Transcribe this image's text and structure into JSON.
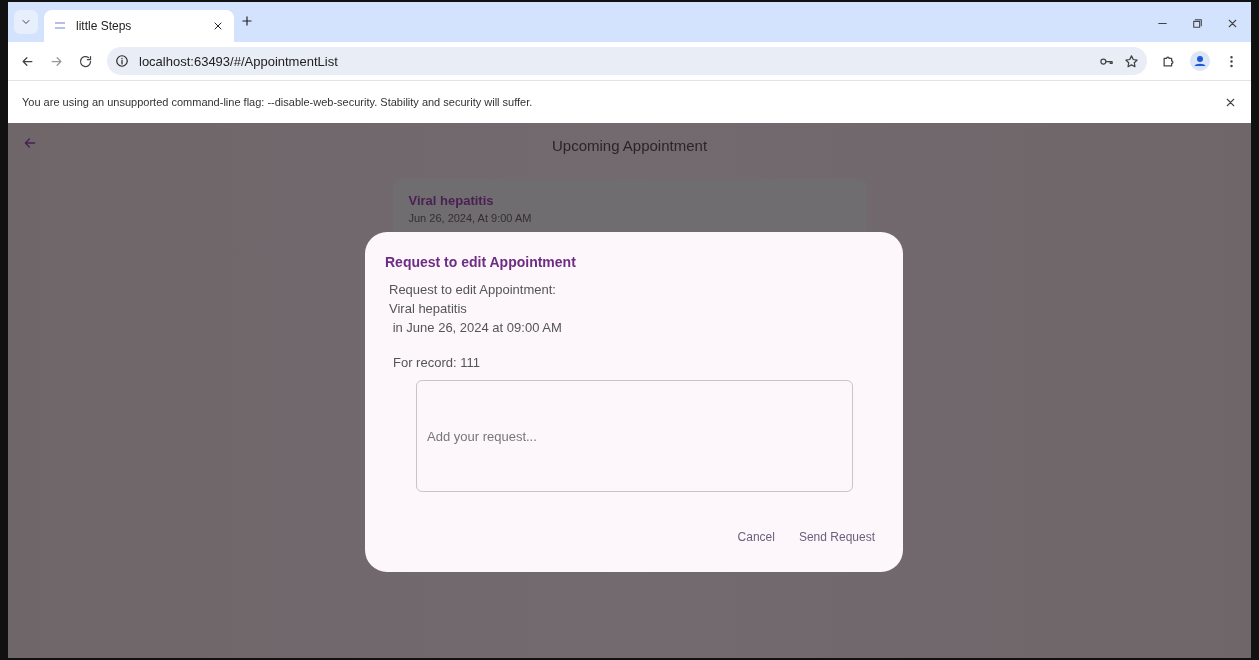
{
  "browser": {
    "tab": {
      "title": "little Steps",
      "selected": true
    },
    "address": "localhost:63493/#/AppointmentList",
    "infobar": "You are using an unsupported command-line flag: --disable-web-security. Stability and security will suffer."
  },
  "app": {
    "title": "Upcoming Appointment",
    "appointments": [
      {
        "title": "Viral hepatitis",
        "datetime": "Jun 26, 2024,  At 9:00 AM"
      }
    ]
  },
  "dialog": {
    "title": "Request to edit Appointment",
    "message": "Request to edit Appointment:\nViral hepatitis\n in June 26, 2024 at 09:00 AM",
    "record": "For record: 111",
    "request_field": {
      "placeholder": "Add your request..."
    },
    "buttons": [
      "Cancel",
      "Send Request"
    ]
  }
}
